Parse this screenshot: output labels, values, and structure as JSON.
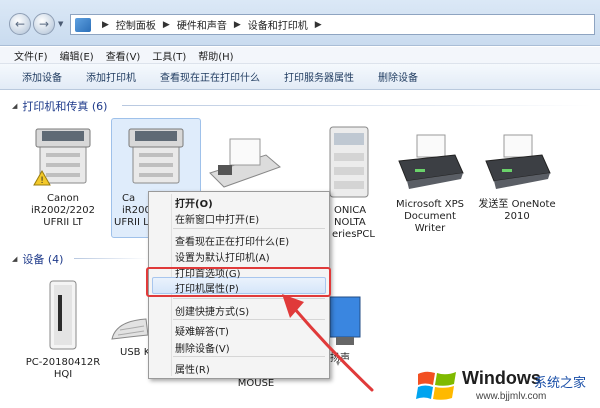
{
  "address_bar": {
    "segments": [
      "控制面板",
      "硬件和声音",
      "设备和打印机"
    ]
  },
  "menu_bar": [
    "文件(F)",
    "编辑(E)",
    "查看(V)",
    "工具(T)",
    "帮助(H)"
  ],
  "command_bar": [
    "添加设备",
    "添加打印机",
    "查看现在正在打印什么",
    "打印服务器属性",
    "删除设备"
  ],
  "printers_group": {
    "title": "打印机和传真 (6)",
    "items": [
      {
        "lines": [
          "Canon",
          "iR2002/2202",
          "UFRII LT"
        ]
      },
      {
        "lines": [
          "Ca",
          "iR200",
          "UFRII L"
        ]
      },
      {
        "lines": [
          ""
        ]
      },
      {
        "lines": [
          "ONICA",
          "NOLTA",
          "eriesPCL"
        ]
      },
      {
        "lines": [
          "Microsoft XPS",
          "Document",
          "Writer"
        ]
      },
      {
        "lines": [
          "发送至 OneNote",
          "2010"
        ]
      }
    ]
  },
  "devices_group": {
    "title": "设备 (4)",
    "items": [
      {
        "lines": [
          "PC-20180412R",
          "HQI"
        ]
      },
      {
        "lines": [
          "USB K"
        ]
      },
      {
        "lines": [
          "MOUSE"
        ]
      },
      {
        "lines": [
          "扬声"
        ]
      }
    ]
  },
  "context_menu": {
    "items": [
      {
        "label": "打开(O)",
        "bold": true
      },
      {
        "label": "在新窗口中打开(E)"
      },
      {
        "label": "查看现在正在打印什么(E)"
      },
      {
        "label": "设置为默认打印机(A)"
      },
      {
        "label": "打印首选项(G)"
      },
      {
        "label": "打印机属性(P)",
        "highlighted": true
      },
      {
        "label": "创建快捷方式(S)"
      },
      {
        "label": "疑难解答(T)"
      },
      {
        "label": "删除设备(V)"
      },
      {
        "label": "属性(R)"
      }
    ]
  },
  "watermark": {
    "brand": "Windows",
    "cn": "系统之家",
    "url": "www.bjjmlv.com"
  },
  "colors": {
    "accent_red": "#e03a3a",
    "group_header": "#1e3a8a",
    "selection": "#c5dcf7"
  }
}
